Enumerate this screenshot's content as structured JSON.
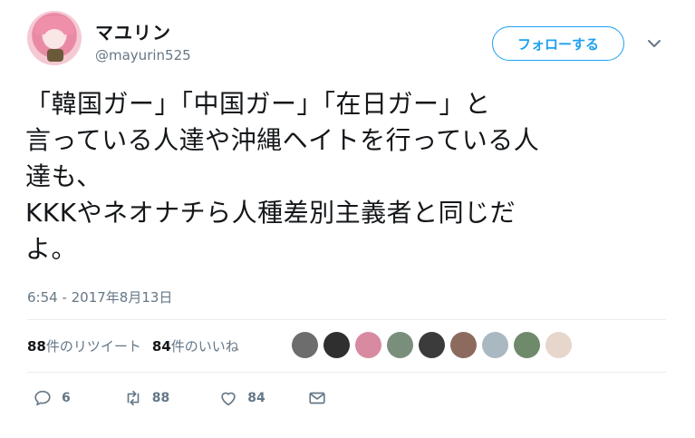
{
  "user": {
    "display_name": "マユリン",
    "handle": "@mayurin525"
  },
  "header": {
    "follow_label": "フォローする",
    "more_icon": "chevron-down-icon"
  },
  "tweet": {
    "text": "「韓国ガー」「中国ガー」「在日ガー」と\n言っている人達や沖縄ヘイトを行っている人\n達も、\nKKKやネオナチら人種差別主義者と同じだ\nよ。",
    "timestamp": "6:54 - 2017年8月13日"
  },
  "stats": {
    "retweet_count": "88",
    "retweet_label": "件のリツイート",
    "like_count": "84",
    "like_label": "件のいいね"
  },
  "likers": [
    {
      "name": "liker-avatar-1",
      "color": "#6d6d6d"
    },
    {
      "name": "liker-avatar-2",
      "color": "#2f2f2f"
    },
    {
      "name": "liker-avatar-3",
      "color": "#d88aa0"
    },
    {
      "name": "liker-avatar-4",
      "color": "#7a8f7b"
    },
    {
      "name": "liker-avatar-5",
      "color": "#3b3b3b"
    },
    {
      "name": "liker-avatar-6",
      "color": "#8c6b5e"
    },
    {
      "name": "liker-avatar-7",
      "color": "#aab8c2"
    },
    {
      "name": "liker-avatar-8",
      "color": "#6f8a6a"
    },
    {
      "name": "liker-avatar-9",
      "color": "#e7d6cc"
    }
  ],
  "actions": {
    "reply_count": "6",
    "retweet_count": "88",
    "like_count": "84"
  },
  "colors": {
    "accent": "#1da1f2",
    "muted": "#657786",
    "text": "#14171a",
    "divider": "#e6ecf0"
  }
}
